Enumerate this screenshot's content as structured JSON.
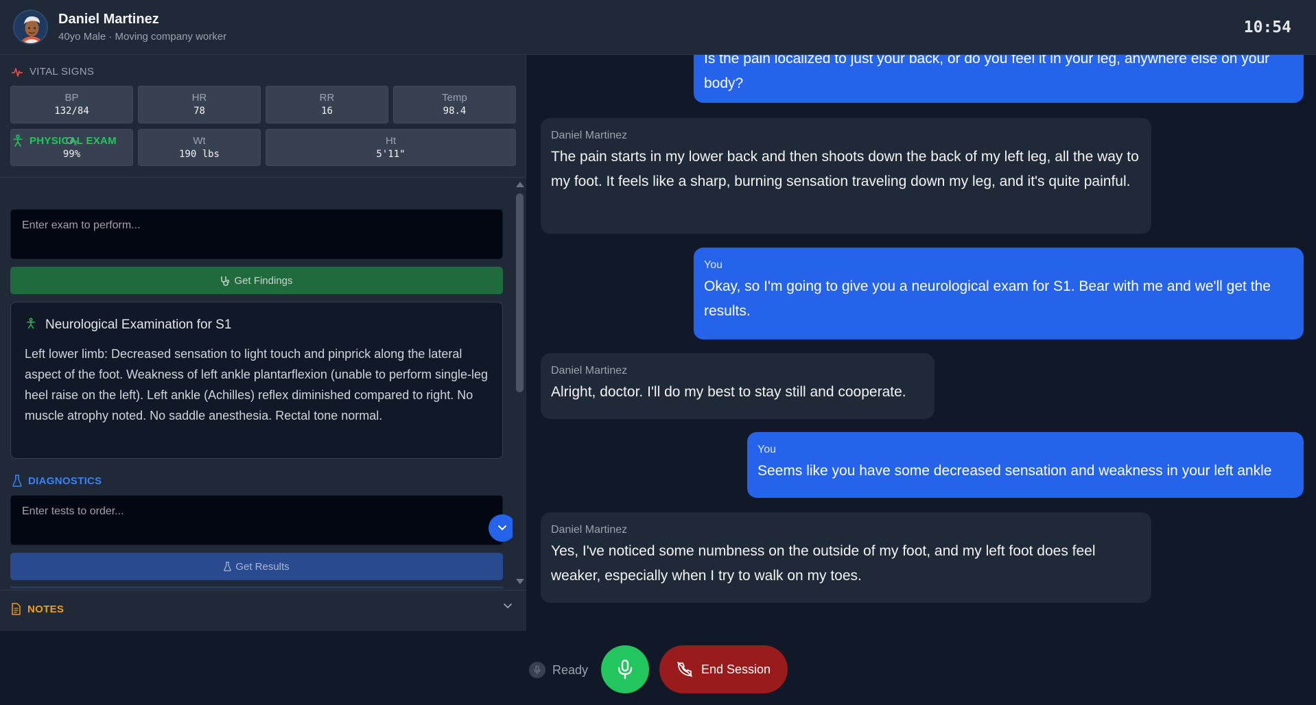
{
  "header": {
    "name": "Daniel Martinez",
    "subtitle": "40yo Male · Moving company worker",
    "clock": "10:54"
  },
  "vitals": {
    "title": "VITAL SIGNS",
    "items": [
      {
        "label": "BP",
        "value": "132/84"
      },
      {
        "label": "HR",
        "value": "78"
      },
      {
        "label": "RR",
        "value": "16"
      },
      {
        "label": "Temp",
        "value": "98.4"
      },
      {
        "label": "O₂",
        "value": "99%"
      },
      {
        "label": "Wt",
        "value": "190 lbs"
      },
      {
        "label": "Ht",
        "value": "5'11\""
      }
    ]
  },
  "exam": {
    "title": "PHYSICAL EXAM",
    "placeholder": "Enter exam to perform...",
    "button": "Get Findings",
    "finding_title": "Neurological Examination for S1",
    "finding_text": "Left lower limb: Decreased sensation to light touch and pinprick along the lateral aspect of the foot. Weakness of left ankle plantarflexion (unable to perform single-leg heel raise on the left). Left ankle (Achilles) reflex diminished compared to right. No muscle atrophy noted. No saddle anesthesia. Rectal tone normal."
  },
  "diagnostics": {
    "title": "DIAGNOSTICS",
    "placeholder": "Enter tests to order...",
    "button": "Get Results"
  },
  "notes": {
    "title": "NOTES"
  },
  "chat": {
    "messages": [
      {
        "from": "You",
        "text": "Is the pain localized to just your back, or do you feel it in your leg, anywhere else on your body?"
      },
      {
        "from": "Daniel Martinez",
        "text": "The pain starts in my lower back and then shoots down the back of my left leg, all the way to my foot. It feels like a sharp, burning sensation traveling down my leg, and it's quite painful."
      },
      {
        "from": "You",
        "text": "Okay, so I'm going to give you a neurological exam for S1. Bear with me and we'll get the results."
      },
      {
        "from": "Daniel Martinez",
        "text": "Alright, doctor. I'll do my best to stay still and cooperate."
      },
      {
        "from": "You",
        "text": "Seems like you have some decreased sensation and weakness in your left ankle"
      },
      {
        "from": "Daniel Martinez",
        "text": "Yes, I've noticed some numbness on the outside of my foot, and my left foot does feel weaker, especially when I try to walk on my toes."
      }
    ]
  },
  "controls": {
    "status": "Ready",
    "end_label": "End Session"
  },
  "colors": {
    "accent_blue": "#2563eb",
    "exam_green": "#22c55e",
    "end_red": "#991b1b",
    "notes_amber": "#f59e0b"
  }
}
